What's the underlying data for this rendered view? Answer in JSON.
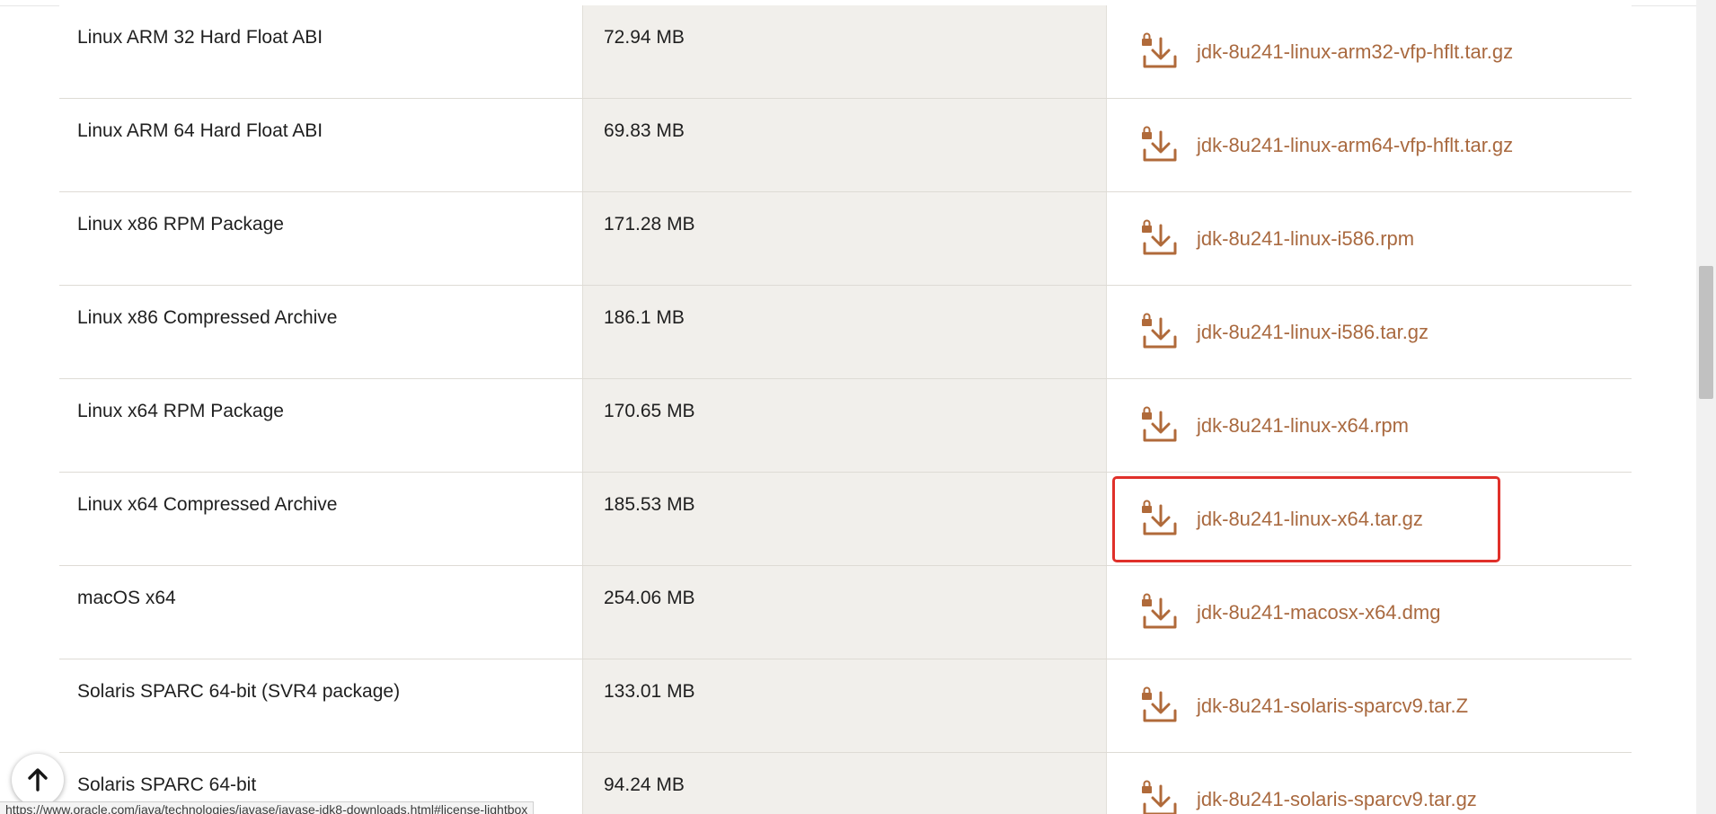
{
  "table": {
    "rows": [
      {
        "product": "Linux ARM 32 Hard Float ABI",
        "size": "72.94 MB",
        "file": "jdk-8u241-linux-arm32-vfp-hflt.tar.gz"
      },
      {
        "product": "Linux ARM 64 Hard Float ABI",
        "size": "69.83 MB",
        "file": "jdk-8u241-linux-arm64-vfp-hflt.tar.gz"
      },
      {
        "product": "Linux x86 RPM Package",
        "size": "171.28 MB",
        "file": "jdk-8u241-linux-i586.rpm"
      },
      {
        "product": "Linux x86 Compressed Archive",
        "size": "186.1 MB",
        "file": "jdk-8u241-linux-i586.tar.gz"
      },
      {
        "product": "Linux x64 RPM Package",
        "size": "170.65 MB",
        "file": "jdk-8u241-linux-x64.rpm"
      },
      {
        "product": "Linux x64 Compressed Archive",
        "size": "185.53 MB",
        "file": "jdk-8u241-linux-x64.tar.gz"
      },
      {
        "product": "macOS x64",
        "size": "254.06 MB",
        "file": "jdk-8u241-macosx-x64.dmg"
      },
      {
        "product": "Solaris SPARC 64-bit (SVR4 package)",
        "size": "133.01 MB",
        "file": "jdk-8u241-solaris-sparcv9.tar.Z"
      },
      {
        "product": "Solaris SPARC 64-bit",
        "size": "94.24 MB",
        "file": "jdk-8u241-solaris-sparcv9.tar.gz"
      }
    ],
    "highlighted_file": "jdk-8u241-linux-x64.tar.gz"
  },
  "status_bar": {
    "url": "https://www.oracle.com/java/technologies/javase/javase-jdk8-downloads.html#license-lightbox"
  },
  "icons": {
    "download": "download-locked-icon",
    "back_to_top": "arrow-up-icon"
  },
  "colors": {
    "link": "#a9693f",
    "size_column_bg": "#f1efeb",
    "highlight": "#e0302a"
  }
}
